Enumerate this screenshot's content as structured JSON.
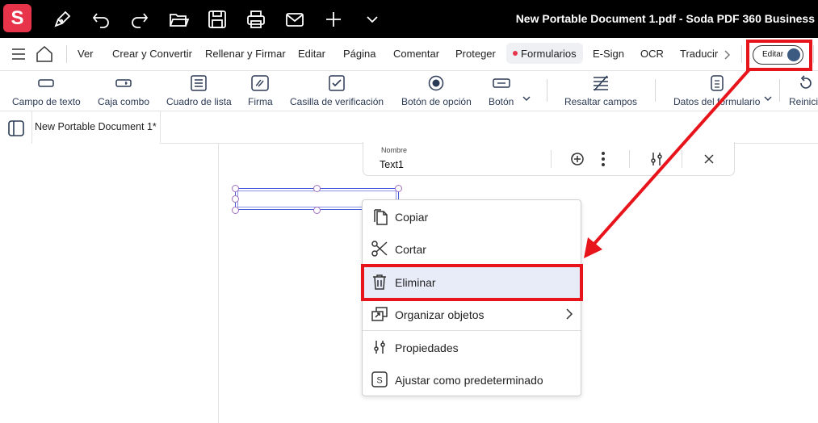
{
  "titlebar": {
    "logo_letter": "S",
    "title": "New Portable Document 1.pdf  -  Soda PDF 360 Business",
    "icons": [
      "pen-icon",
      "undo-icon",
      "redo-icon",
      "open-folder-icon",
      "save-icon",
      "print-icon",
      "mail-icon",
      "plus-icon",
      "chevron-down-icon"
    ]
  },
  "menubar": {
    "items": [
      "Ver",
      "Crear y Convertir",
      "Rellenar y Firmar",
      "Editar",
      "Página",
      "Comentar",
      "Proteger",
      "Formularios",
      "E-Sign",
      "OCR",
      "Traducir"
    ],
    "active": "Formularios",
    "toggle_label": "Editar"
  },
  "ribbon": {
    "items": [
      "Campo de texto",
      "Caja combo",
      "Cuadro de lista",
      "Firma",
      "Casilla de verificación",
      "Botón de opción",
      "Botón",
      "Resaltar campos",
      "Datos del formulario",
      "Reinicia"
    ]
  },
  "tab": {
    "label": "New Portable Document 1*"
  },
  "field_panel": {
    "label": "Nombre",
    "value": "Text1"
  },
  "context_menu": {
    "items": [
      "Copiar",
      "Cortar",
      "Eliminar",
      "Organizar objetos",
      "Propiedades",
      "Ajustar como predeterminado"
    ],
    "highlighted": "Eliminar"
  },
  "colors": {
    "brand": "#e8344a",
    "annotation": "#e8141c",
    "accent": "#3d5a80",
    "highlight": "#e8ecf8"
  }
}
